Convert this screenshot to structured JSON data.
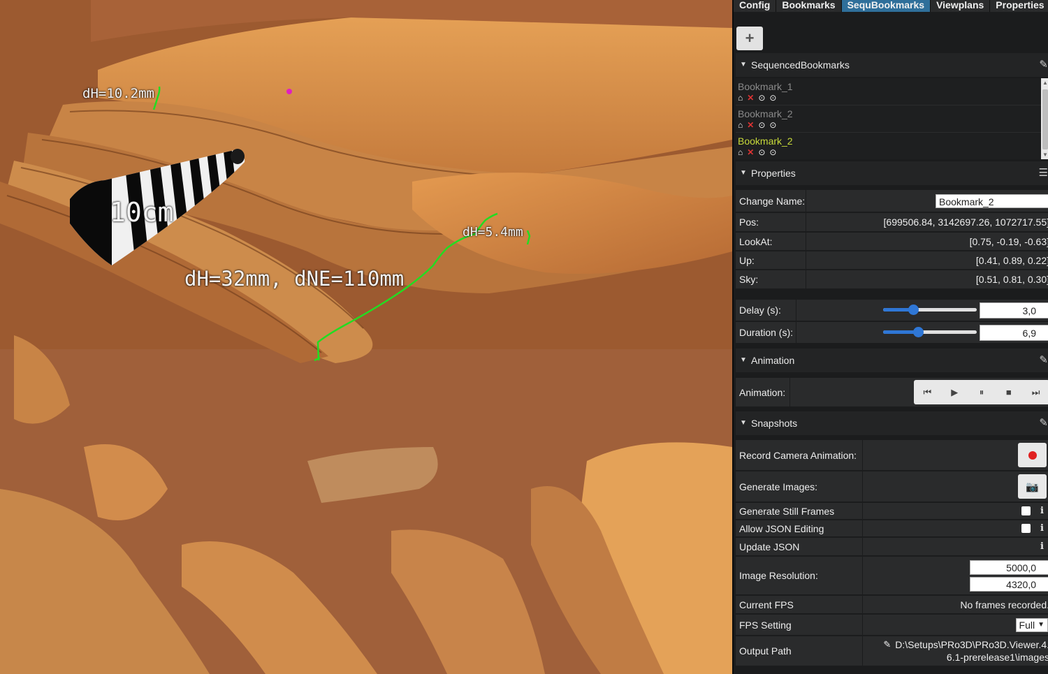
{
  "viewport": {
    "labels": {
      "dh_top": "dH=10.2mm",
      "dh_right": "dH=5.4mm",
      "dh_main": "dH=32mm, dNE=110mm",
      "scale_bar": "10cm"
    }
  },
  "tabs": [
    "Config",
    "Bookmarks",
    "SequBookmarks",
    "Viewplans",
    "Properties"
  ],
  "add_button": "+",
  "sections": {
    "sequenced": "SequencedBookmarks",
    "properties": "Properties",
    "animation": "Animation",
    "snapshots": "Snapshots"
  },
  "bookmarks": [
    {
      "name": "Bookmark_1",
      "active": false
    },
    {
      "name": "Bookmark_2",
      "active": false
    },
    {
      "name": "Bookmark_2",
      "active": true
    }
  ],
  "properties": {
    "change_name_label": "Change Name:",
    "change_name_value": "Bookmark_2",
    "pos_label": "Pos:",
    "pos_value": "[699506.84, 3142697.26, 1072717.55]",
    "lookat_label": "LookAt:",
    "lookat_value": "[0.75, -0.19, -0.63]",
    "up_label": "Up:",
    "up_value": "[0.41, 0.89, 0.22]",
    "sky_label": "Sky:",
    "sky_value": "[0.51, 0.81, 0.30]",
    "delay_label": "Delay (s):",
    "delay_value": "3,0",
    "delay_fraction": 0.3,
    "duration_label": "Duration (s):",
    "duration_value": "6,9",
    "duration_fraction": 0.36
  },
  "animation": {
    "label": "Animation:",
    "controls": [
      "step-backward-icon",
      "play-icon",
      "pause-icon",
      "stop-icon",
      "step-forward-icon"
    ]
  },
  "snapshots": {
    "record_label": "Record Camera Animation:",
    "generate_images_label": "Generate Images:",
    "still_frames_label": "Generate Still Frames",
    "allow_json_label": "Allow JSON Editing",
    "update_json_label": "Update JSON",
    "image_resolution_label": "Image Resolution:",
    "res_width": "5000,0",
    "res_height": "4320,0",
    "current_fps_label": "Current FPS",
    "current_fps_value": "No frames recorded.",
    "fps_setting_label": "FPS Setting",
    "fps_setting_value": "Full",
    "output_path_label": "Output Path",
    "output_path_line1": "D:\\Setups\\PRo3D\\PRo3D.Viewer.4.",
    "output_path_line2": "6.1-prerelease1\\images"
  },
  "colors": {
    "panel_bg": "#1b1c1d",
    "row_bg": "#2a2b2c",
    "active_tab": "#2f6f9a",
    "active_bookmark": "#c7d93a",
    "measure_line": "#22dd22",
    "record": "#e02020"
  }
}
